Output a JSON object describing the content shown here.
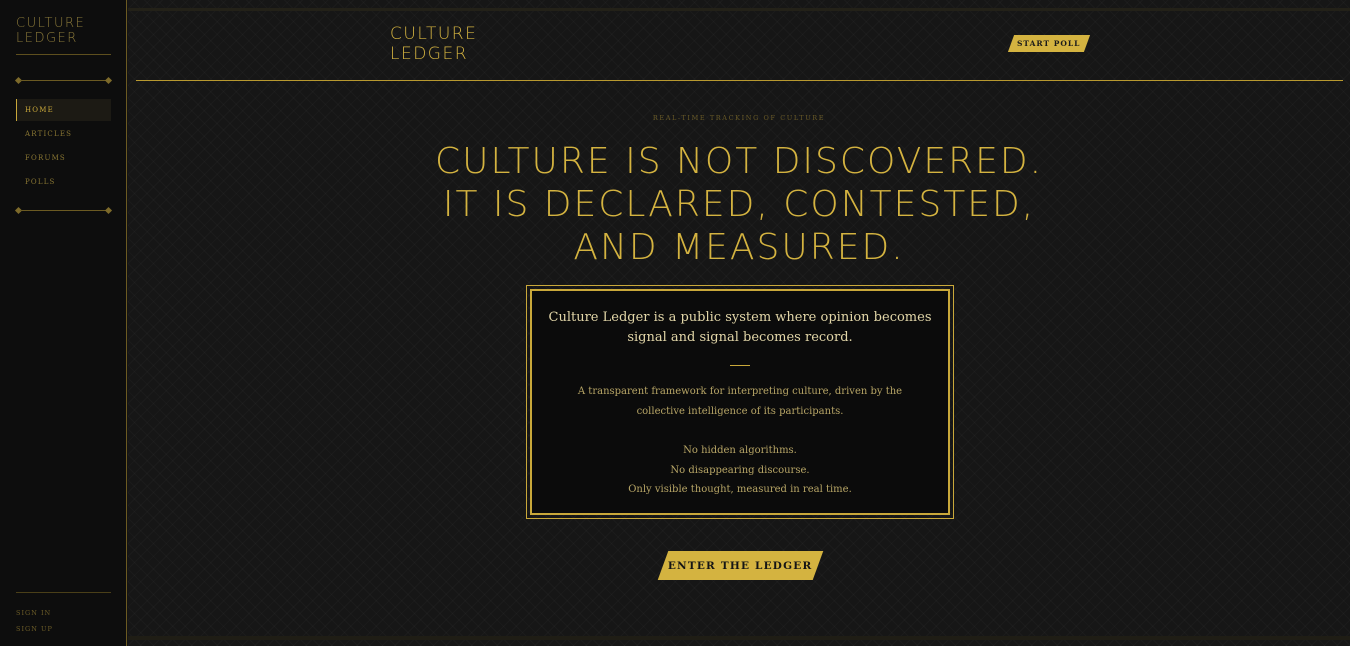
{
  "sidebar": {
    "logo_line1": "CULTURE",
    "logo_line2": "LEDGER",
    "nav": [
      {
        "label": "HOME",
        "active": true
      },
      {
        "label": "ARTICLES",
        "active": false
      },
      {
        "label": "FORUMS",
        "active": false
      },
      {
        "label": "POLLS",
        "active": false
      }
    ],
    "sign_in": "SIGN IN",
    "sign_up": "SIGN UP"
  },
  "header": {
    "logo_line1": "CULTURE",
    "logo_line2": "LEDGER",
    "start_poll_label": "START POLL"
  },
  "hero": {
    "eyebrow": "REAL-TIME TRACKING OF CULTURE",
    "headline": [
      "CULTURE IS NOT DISCOVERED.",
      "IT IS DECLARED, CONTESTED,",
      "AND MEASURED."
    ]
  },
  "card": {
    "lead": "Culture Ledger is a public system where opinion becomes signal and signal becomes record.",
    "text1_line1": "A transparent framework for interpreting culture, driven by the",
    "text1_line2": "collective intelligence of its participants.",
    "points": [
      "No hidden algorithms.",
      "No disappearing discourse.",
      "Only visible thought, measured in real time."
    ]
  },
  "cta": {
    "enter_label": "ENTER THE LEDGER"
  },
  "colors": {
    "accent": "#d4b340",
    "background": "#141414",
    "sidebar": "#0d0d0d"
  }
}
